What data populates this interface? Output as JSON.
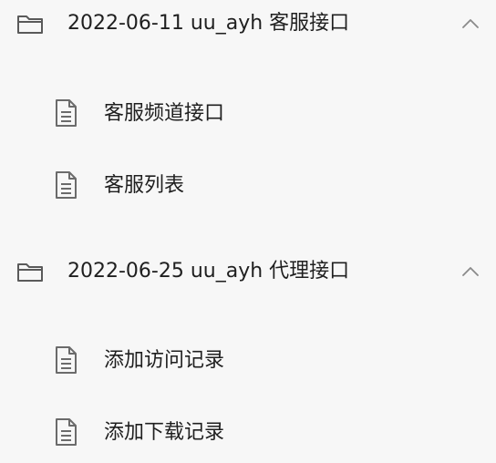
{
  "groups": [
    {
      "title": "2022-06-11 uu_ayh 客服接口",
      "icon": "folder-icon",
      "toggle_icon": "chevron-up-icon",
      "expanded": true,
      "items": [
        {
          "label": "客服频道接口",
          "icon": "document-icon"
        },
        {
          "label": "客服列表",
          "icon": "document-icon"
        }
      ]
    },
    {
      "title": "2022-06-25 uu_ayh 代理接口",
      "icon": "folder-icon",
      "toggle_icon": "chevron-up-icon",
      "expanded": true,
      "items": [
        {
          "label": "添加访问记录",
          "icon": "document-icon"
        },
        {
          "label": "添加下载记录",
          "icon": "document-icon"
        }
      ]
    }
  ],
  "colors": {
    "background": "#f7f7f7",
    "text": "#1f1f1f",
    "icon": "#6b6b6b",
    "chevron": "#8a8a8a"
  }
}
